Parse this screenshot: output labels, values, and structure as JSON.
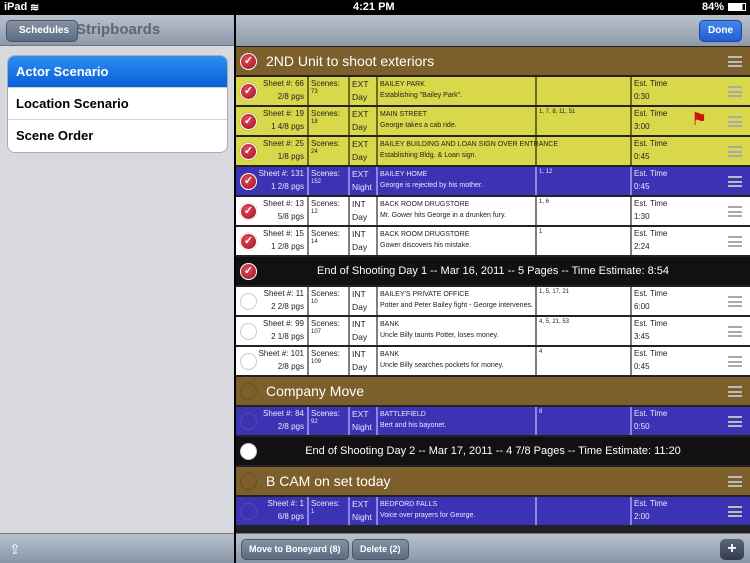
{
  "status": {
    "device": "iPad",
    "time": "4:21 PM",
    "battery": "84%"
  },
  "left": {
    "back": "Schedules",
    "title": "Stripboards",
    "items": [
      {
        "label": "Actor Scenario",
        "selected": true
      },
      {
        "label": "Location Scenario"
      },
      {
        "label": "Scene Order"
      }
    ]
  },
  "right": {
    "done": "Done",
    "move": "Move to Boneyard (8)",
    "delete": "Delete (2)",
    "add": "+",
    "labels": {
      "sheet": "Sheet #:",
      "scenes": "Scenes:",
      "est": "Est. Time"
    },
    "rows": [
      {
        "kind": "hdr",
        "title": "2ND Unit to shoot exteriors",
        "checked": true
      },
      {
        "kind": "strip",
        "color": "y",
        "checked": true,
        "sheet": "66",
        "pgs": "2/8 pgs",
        "scene": "73",
        "ie": "EXT",
        "dn": "Day",
        "set": "BAILEY PARK",
        "desc": "Establishing \"Bailey Park\".",
        "cast": "",
        "time": "0:30"
      },
      {
        "kind": "strip",
        "color": "y",
        "checked": true,
        "sheet": "19",
        "pgs": "1 4/8 pgs",
        "scene": "18",
        "ie": "EXT",
        "dn": "Day",
        "set": "MAIN STREET",
        "desc": "George takes a cab ride.",
        "cast": "1, 7, 8, 11, 51",
        "time": "3:00",
        "flag": true
      },
      {
        "kind": "strip",
        "color": "y",
        "checked": true,
        "sheet": "25",
        "pgs": "1/8 pgs",
        "scene": "24",
        "ie": "EXT",
        "dn": "Day",
        "set": "BAILEY BUILDING AND LOAN SIGN OVER ENTRANCE",
        "desc": "Establishing Bldg. & Loan sign.",
        "cast": "",
        "time": "0:45"
      },
      {
        "kind": "strip",
        "color": "b",
        "checked": true,
        "sheet": "131",
        "pgs": "1 2/8 pgs",
        "scene": "152",
        "ie": "EXT",
        "dn": "Night",
        "set": "BAILEY HOME",
        "desc": "George is rejected by his mother.",
        "cast": "1, 12",
        "time": "0:45"
      },
      {
        "kind": "strip",
        "color": "w",
        "checked": true,
        "sheet": "13",
        "pgs": "5/8 pgs",
        "scene": "12",
        "ie": "INT",
        "dn": "Day",
        "set": "BACK ROOM DRUGSTORE",
        "desc": "Mr. Gower hits George in a drunken fury.",
        "cast": "1, 6",
        "time": "1:30"
      },
      {
        "kind": "strip",
        "color": "w",
        "checked": true,
        "sheet": "15",
        "pgs": "1 2/8 pgs",
        "scene": "14",
        "ie": "INT",
        "dn": "Day",
        "set": "BACK ROOM DRUGSTORE",
        "desc": "Gower discovers his mistake.",
        "cast": "1",
        "time": "2:24"
      },
      {
        "kind": "eod",
        "title": "End of Shooting Day 1 -- Mar 16, 2011 -- 5 Pages -- Time Estimate: 8:54",
        "checked": true
      },
      {
        "kind": "strip",
        "color": "w",
        "checked": false,
        "sheet": "11",
        "pgs": "2 2/8 pgs",
        "scene": "10",
        "ie": "INT",
        "dn": "Day",
        "set": "BAILEY'S PRIVATE OFFICE",
        "desc": "Potter and Peter Bailey fight - George intervenes.",
        "cast": "1, 5, 17, 21",
        "time": "6:00"
      },
      {
        "kind": "strip",
        "color": "w",
        "checked": false,
        "sheet": "99",
        "pgs": "2 1/8 pgs",
        "scene": "107",
        "ie": "INT",
        "dn": "Day",
        "set": "BANK",
        "desc": "Uncle Billy taunts Potter, loses money.",
        "cast": "4, 5, 21, 53",
        "time": "3:45"
      },
      {
        "kind": "strip",
        "color": "w",
        "checked": false,
        "sheet": "101",
        "pgs": "2/8 pgs",
        "scene": "109",
        "ie": "INT",
        "dn": "Day",
        "set": "BANK",
        "desc": "Uncle Billy searches pockets for money.",
        "cast": "4",
        "time": "0:45"
      },
      {
        "kind": "hdr",
        "title": "Company Move",
        "checked": false
      },
      {
        "kind": "strip",
        "color": "b",
        "checked": false,
        "sheet": "84",
        "pgs": "2/8 pgs",
        "scene": "92",
        "ie": "EXT",
        "dn": "Night",
        "set": "BATTLEFIELD",
        "desc": "Bert and his bayonet.",
        "cast": "8",
        "time": "0:50"
      },
      {
        "kind": "eod",
        "title": "End of Shooting Day 2 -- Mar 17, 2011 -- 4 7/8 Pages -- Time Estimate: 11:20",
        "checked": false
      },
      {
        "kind": "hdr",
        "title": "B CAM  on set today",
        "checked": false
      },
      {
        "kind": "strip",
        "color": "b",
        "checked": false,
        "sheet": "1",
        "pgs": "6/8 pgs",
        "scene": "1",
        "ie": "EXT",
        "dn": "Night",
        "set": "BEDFORD FALLS",
        "desc": "Voice over prayers for George.",
        "cast": "",
        "time": "2:00"
      }
    ]
  },
  "colors": {
    "header": "#7d5f2c",
    "yellow": "#d8d84a",
    "blue": "#3b33b4",
    "selected": "#0a5fd9"
  }
}
